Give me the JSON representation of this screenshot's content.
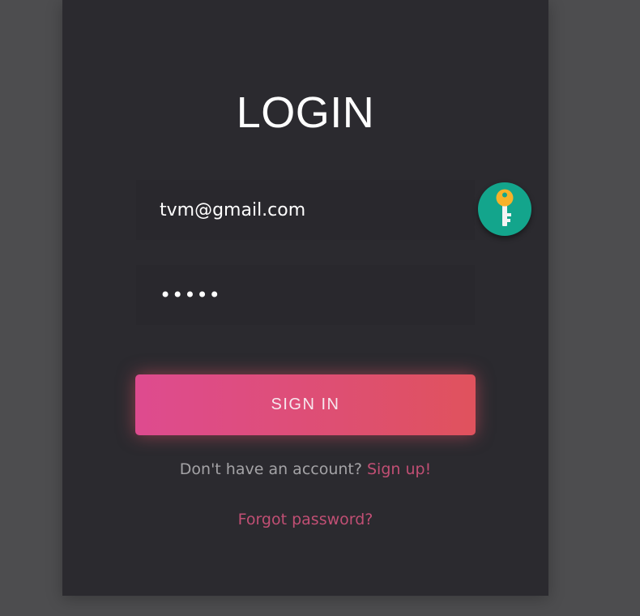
{
  "login": {
    "title": "LOGIN",
    "email_value": "tvm@gmail.com",
    "password_value": "•••••",
    "signin_label": "SIGN IN",
    "no_account_text": "Don't have an account?",
    "signup_link": "Sign up!",
    "forgot_link": "Forgot password?",
    "key_icon": "key-icon"
  },
  "colors": {
    "page_bg": "#4d4d4f",
    "card_bg": "#2b2a2f",
    "key_button": "#13a58c",
    "key_icon": "#f6b22a",
    "button_gradient_start": "#de4b8f",
    "button_gradient_end": "#e0525d",
    "link": "#c14f74"
  }
}
